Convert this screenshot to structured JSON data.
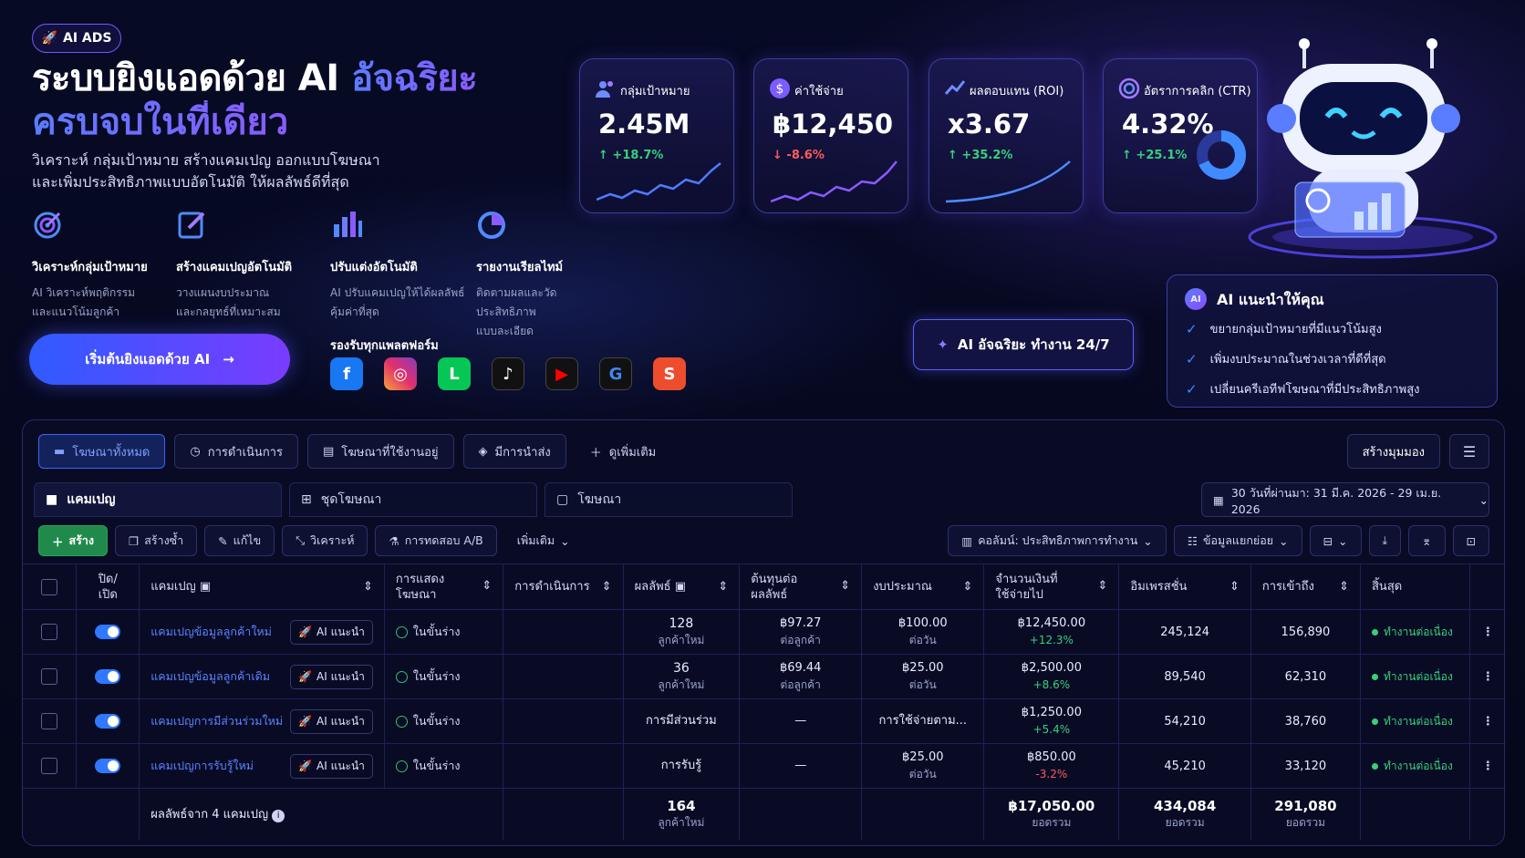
{
  "hero": {
    "badge": "AI ADS",
    "title_line1": "ระบบยิงแอดด้วย AI",
    "title_accent": "อัจฉริยะ",
    "title_line2": "ครบจบในที่เดียว",
    "subtitle_line1": "วิเคราะห์ กลุ่มเป้าหมาย สร้างแคมเปญ ออกแบบโฆษณา",
    "subtitle_line2": "และเพิ่มประสิทธิภาพแบบอัตโนมัติ ให้ผลลัพธ์ดีที่สุด",
    "cta": "เริ่มต้นยิงแอดด้วย AI"
  },
  "features": [
    {
      "title": "วิเคราะห์กลุ่มเป้าหมาย",
      "line1": "AI วิเคราะห์พฤติกรรม",
      "line2": "และแนวโน้มลูกค้า",
      "icon": "target-icon"
    },
    {
      "title": "สร้างแคมเปญอัตโนมัติ",
      "line1": "วางแผนงบประมาณ",
      "line2": "และกลยุทธ์ที่เหมาะสม",
      "icon": "edit-icon"
    },
    {
      "title": "ปรับแต่งอัตโนมัติ",
      "line1": "AI ปรับแคมเปญให้ได้ผลลัพธ์",
      "line2": "คุ้มค่าที่สุด",
      "icon": "bar-chart-icon"
    },
    {
      "title": "รายงานเรียลไทม์",
      "line1": "ติดตามผลและวัดประสิทธิภาพ",
      "line2": "แบบละเอียด",
      "icon": "pie-chart-icon"
    }
  ],
  "platforms": {
    "label": "รองรับทุกแพลตฟอร์ม",
    "items": [
      {
        "name": "facebook",
        "glyph": "f",
        "color": "#1877f2"
      },
      {
        "name": "instagram",
        "glyph": "◎",
        "color": "#e1306c"
      },
      {
        "name": "line",
        "glyph": "L",
        "color": "#06c755"
      },
      {
        "name": "tiktok",
        "glyph": "♪",
        "color": "#111111"
      },
      {
        "name": "youtube",
        "glyph": "▶",
        "color": "#ff0000"
      },
      {
        "name": "google",
        "glyph": "G",
        "color": "#ffffff"
      },
      {
        "name": "shopee",
        "glyph": "S",
        "color": "#ee4d2d"
      }
    ]
  },
  "metrics": [
    {
      "label": "กลุ่มเป้าหมาย",
      "value": "2.45M",
      "delta": "+18.7%",
      "dir": "up",
      "icon": "users-icon"
    },
    {
      "label": "ค่าใช้จ่าย",
      "value": "฿12,450",
      "delta": "-8.6%",
      "dir": "down",
      "icon": "dollar-icon"
    },
    {
      "label": "ผลตอบแทน (ROI)",
      "value": "x3.67",
      "delta": "+35.2%",
      "dir": "up",
      "icon": "trend-icon"
    },
    {
      "label": "อัตราการคลิก (CTR)",
      "value": "4.32%",
      "delta": "+25.1%",
      "dir": "up",
      "icon": "target-icon"
    }
  ],
  "ai247": "AI อัจฉริยะ ทำงาน 24/7",
  "recommend": {
    "icon_text": "AI",
    "title": "AI แนะนำให้คุณ",
    "items": [
      "ขยายกลุ่มเป้าหมายที่มีแนวโน้มสูง",
      "เพิ่มงบประมาณในช่วงเวลาที่ดีที่สุด",
      "เปลี่ยนครีเอทีฟโฆษณาที่มีประสิทธิภาพสูง"
    ]
  },
  "manager": {
    "tabs": [
      "โฆษณาทั้งหมด",
      "การดำเนินการ",
      "โฆษณาที่ใช้งานอยู่",
      "มีการนำส่ง"
    ],
    "more_tab": "ดูเพิ่มเติม",
    "create_view": "สร้างมุมมอง",
    "sub_tabs": [
      "แคมเปญ",
      "ชุดโฆษณา",
      "โฆษณา"
    ],
    "date_range": "30 วันที่ผ่านมา: 31 มี.ค. 2026 - 29 เม.ย. 2026",
    "toolbar": {
      "create": "สร้าง",
      "duplicate": "สร้างซ้ำ",
      "edit": "แก้ไข",
      "analyze": "วิเคราะห์",
      "ab_test": "การทดสอบ A/B",
      "more": "เพิ่มเติม",
      "columns": "คอลัมน์: ประสิทธิภาพการทำงาน",
      "breakdown": "ข้อมูลแยกย่อย"
    },
    "columns": {
      "onoff": "ปิด/\nเปิด",
      "campaign": "แคมเปญ",
      "delivery": "การแสดง\nโฆษณา",
      "actions": "การดำเนินการ",
      "results": "ผลลัพธ์",
      "cost_per": "ต้นทุนต่อ\nผลลัพธ์",
      "budget": "งบประมาณ",
      "spent": "จำนวนเงินที่\nใช้จ่ายไป",
      "impressions": "อิมเพรสชั่น",
      "reach": "การเข้าถึง",
      "end": "สิ้นสุด"
    },
    "rows": [
      {
        "name": "แคมเปญข้อมูลลูกค้าใหม่",
        "ai": "AI แนะนำ",
        "delivery": "ในขั้นร่าง",
        "result": "128",
        "result_sub": "ลูกค้าใหม่",
        "cost": "฿97.27",
        "cost_sub": "ต่อลูกค้า",
        "budget": "฿100.00",
        "budget_sub": "ต่อวัน",
        "spent": "฿12,450.00",
        "spent_delta": "+12.3%",
        "spent_dir": "up",
        "impressions": "245,124",
        "reach": "156,890",
        "end": "ทำงานต่อเนื่อง"
      },
      {
        "name": "แคมเปญข้อมูลลูกค้าเดิม",
        "ai": "AI แนะนำ",
        "delivery": "ในขั้นร่าง",
        "result": "36",
        "result_sub": "ลูกค้าใหม่",
        "cost": "฿69.44",
        "cost_sub": "ต่อลูกค้า",
        "budget": "฿25.00",
        "budget_sub": "ต่อวัน",
        "spent": "฿2,500.00",
        "spent_delta": "+8.6%",
        "spent_dir": "up",
        "impressions": "89,540",
        "reach": "62,310",
        "end": "ทำงานต่อเนื่อง"
      },
      {
        "name": "แคมเปญการมีส่วนร่วมใหม่",
        "ai": "AI แนะนำ",
        "delivery": "ในขั้นร่าง",
        "result": "การมีส่วนร่วม",
        "result_sub": "",
        "cost": "—",
        "cost_sub": "",
        "budget": "การใช้จ่ายตาม...",
        "budget_sub": "",
        "spent": "฿1,250.00",
        "spent_delta": "+5.4%",
        "spent_dir": "up",
        "impressions": "54,210",
        "reach": "38,760",
        "end": "ทำงานต่อเนื่อง"
      },
      {
        "name": "แคมเปญการรับรู้ใหม่",
        "ai": "AI แนะนำ",
        "delivery": "ในขั้นร่าง",
        "result": "การรับรู้",
        "result_sub": "",
        "cost": "—",
        "cost_sub": "",
        "budget": "฿25.00",
        "budget_sub": "ต่อวัน",
        "spent": "฿850.00",
        "spent_delta": "-3.2%",
        "spent_dir": "down",
        "impressions": "45,210",
        "reach": "33,120",
        "end": "ทำงานต่อเนื่อง"
      }
    ],
    "footer": {
      "label": "ผลลัพธ์จาก 4 แคมเปญ",
      "results": "164",
      "results_sub": "ลูกค้าใหม่",
      "spent": "฿17,050.00",
      "spent_sub": "ยอดรวม",
      "impressions": "434,084",
      "impressions_sub": "ยอดรวม",
      "reach": "291,080",
      "reach_sub": "ยอดรวม"
    }
  },
  "colors": {
    "accent": "#5a7cff",
    "up": "#36d17a",
    "down": "#ff5c5c",
    "toggle": "#2f78ff"
  }
}
